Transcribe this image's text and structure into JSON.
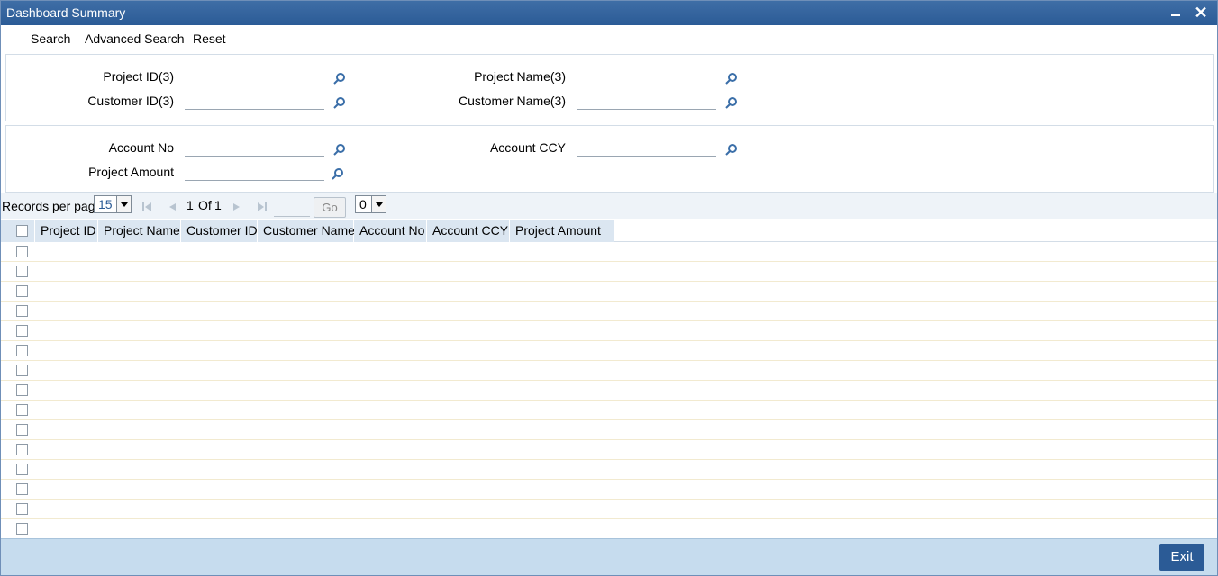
{
  "window": {
    "title": "Dashboard Summary",
    "minimize_label": "",
    "close_symbol": "✕"
  },
  "toolbar": {
    "search_label": "Search",
    "advanced_search_label": "Advanced Search",
    "reset_label": "Reset"
  },
  "criteria": {
    "project_id_label": "Project ID(3)",
    "project_name_label": "Project Name(3)",
    "customer_id_label": "Customer ID(3)",
    "customer_name_label": "Customer Name(3)",
    "account_no_label": "Account No",
    "account_ccy_label": "Account CCY",
    "project_amount_label": "Project Amount",
    "project_id_value": "",
    "project_name_value": "",
    "customer_id_value": "",
    "customer_name_value": "",
    "account_no_value": "",
    "account_ccy_value": "",
    "project_amount_value": ""
  },
  "pager": {
    "records_per_page_label": "Records per page",
    "records_per_page_value": "15",
    "current_page": "1",
    "of_label": "Of",
    "total_pages": "1",
    "go_label": "Go",
    "goto_value": "0"
  },
  "grid": {
    "columns": [
      "Project ID",
      "Project Name",
      "Customer ID",
      "Customer Name",
      "Account No",
      "Account CCY",
      "Project Amount"
    ],
    "row_count": 15
  },
  "footer": {
    "exit_label": "Exit"
  },
  "colors": {
    "title_bar": "#2b5b96",
    "header_cell": "#dbe6f1",
    "footer": "#c6dcee",
    "exit_button": "#2b5b96"
  }
}
